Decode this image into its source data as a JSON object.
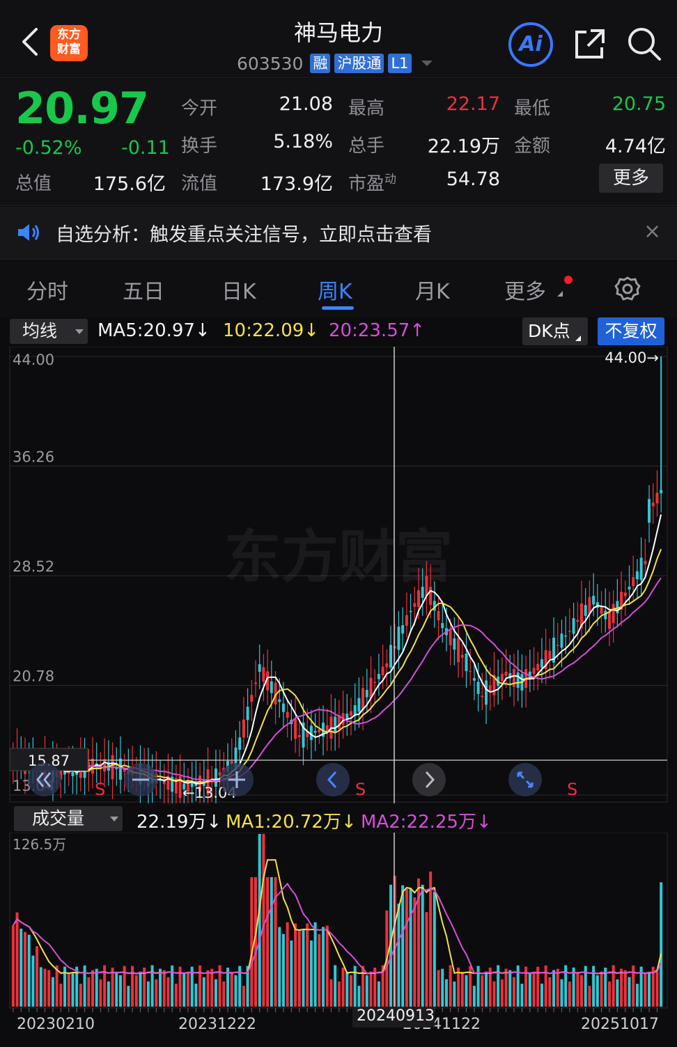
{
  "header": {
    "title": "神马电力",
    "logo_text": [
      "东方",
      "财富"
    ],
    "code": "603530",
    "tags": [
      "融",
      "沪股通",
      "L1"
    ],
    "ai_label": "Ai"
  },
  "quote": {
    "price": "20.97",
    "change_pct": "-0.52%",
    "change": "-0.11",
    "more_label": "更多",
    "fields": [
      {
        "label": "今开",
        "value": "21.08",
        "color": "#f0f0f2"
      },
      {
        "label": "最高",
        "value": "22.17",
        "color": "#f0303a"
      },
      {
        "label": "最低",
        "value": "20.75",
        "color": "#19c74a"
      },
      {
        "label": "换手",
        "value": "5.18%",
        "color": "#f0f0f2"
      },
      {
        "label": "总手",
        "value": "22.19万",
        "color": "#f0f0f2"
      },
      {
        "label": "金额",
        "value": "4.74亿",
        "color": "#f0f0f2"
      },
      {
        "label": "总值",
        "value": "175.6亿",
        "color": "#f0f0f2"
      },
      {
        "label": "流值",
        "value": "173.9亿",
        "color": "#f0f0f2"
      },
      {
        "label": "市盈",
        "label_sup": "动",
        "value": "54.78",
        "color": "#f0f0f2"
      }
    ]
  },
  "notice": {
    "text": "自选分析：触发重点关注信号，立即点击查看",
    "close": "×"
  },
  "tabs": {
    "items": [
      "分时",
      "五日",
      "日K",
      "周K",
      "月K",
      "更多"
    ],
    "active_index": 3
  },
  "ma_row": {
    "selector": "均线",
    "ma5": "MA5:20.97↓",
    "ma10": "10:22.09↓",
    "ma20": "20:23.57↑",
    "dk": "DK点",
    "adjust": "不复权"
  },
  "kline": {
    "y_labels": [
      "44.00",
      "36.26",
      "28.52",
      "20.78",
      "13.04"
    ],
    "max_marker": "44.00→",
    "min_marker": "←13.04",
    "price_line_label": "15.87",
    "s_markers": [
      "S",
      "S",
      "S"
    ],
    "watermark": "东方财富"
  },
  "volume": {
    "selector": "成交量",
    "vol": "22.19万↓",
    "ma1": "MA1:20.72万↓",
    "ma2": "MA2:22.25万↓",
    "y_label": "126.5万",
    "x_labels": [
      "20230210",
      "20231222",
      "20241122",
      "20251017"
    ],
    "cursor_date": "20240913"
  },
  "colors": {
    "up": "#f0303a",
    "down": "#2ec8d4",
    "ma5": "#ffffff",
    "ma10": "#f5e14a",
    "ma20": "#d64fd6",
    "accent": "#3b84ff"
  }
}
